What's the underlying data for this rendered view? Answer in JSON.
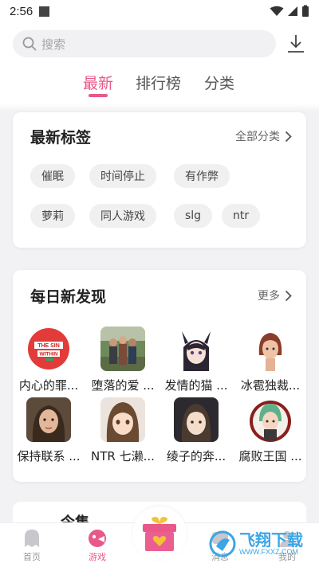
{
  "status": {
    "time": "2:56"
  },
  "search": {
    "placeholder": "搜索"
  },
  "tabs": [
    {
      "label": "最新",
      "active": true
    },
    {
      "label": "排行榜",
      "active": false
    },
    {
      "label": "分类",
      "active": false
    }
  ],
  "tags_card": {
    "title": "最新标签",
    "more": "全部分类",
    "tags": [
      "催眠",
      "时间停止",
      "有作弊",
      "萝莉",
      "同人游戏",
      "slg",
      "ntr"
    ]
  },
  "daily_card": {
    "title": "每日新发现",
    "more": "更多",
    "apps": [
      {
        "name": "内心的罪..."
      },
      {
        "name": "堕落的爱 ..."
      },
      {
        "name": "发情的猫 ..."
      },
      {
        "name": "冰雹独裁..."
      },
      {
        "name": "保持联系 ..."
      },
      {
        "name": "NTR 七濑..."
      },
      {
        "name": "绫子的奔..."
      },
      {
        "name": "腐败王国 ..."
      }
    ],
    "first_logo_text": [
      "THE SIN",
      "WITHIN"
    ]
  },
  "next_section": {
    "title": "今集"
  },
  "bottom_nav": [
    {
      "label": "首页",
      "active": false
    },
    {
      "label": "游戏",
      "active": true
    },
    {
      "label": "消息",
      "active": false
    },
    {
      "label": "我的",
      "active": false
    }
  ],
  "watermark": {
    "text": "飞翔下载",
    "sub": "WWW.FXXZ.COM"
  },
  "colors": {
    "accent": "#e8588a",
    "background": "#f2f2f4"
  }
}
